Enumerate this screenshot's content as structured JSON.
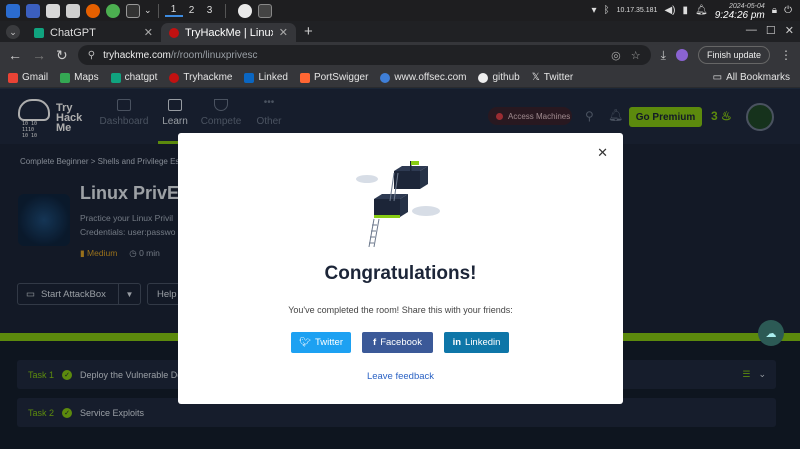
{
  "taskbar": {
    "workspaces": [
      "1",
      "2",
      "3"
    ],
    "ip": "10.17.35.181",
    "date": "2024-05-04",
    "time": "9:24:26 pm"
  },
  "browser": {
    "tabs": [
      {
        "title": "ChatGPT",
        "active": false
      },
      {
        "title": "TryHackMe | Linux PrivEsc",
        "active": true
      }
    ],
    "url_host": "tryhackme.com",
    "url_path": "/r/room/linuxprivesc",
    "finish_update": "Finish update",
    "bookmarks": [
      "Gmail",
      "Maps",
      "chatgpt",
      "Tryhackme",
      "Linked",
      "PortSwigger",
      "www.offsec.com",
      "github",
      "Twitter"
    ],
    "all_bookmarks": "All Bookmarks"
  },
  "nav": {
    "logo_word": "Try Hack Me",
    "logo_bits": "10 10\n1110\n10 10",
    "items": [
      "Dashboard",
      "Learn",
      "Compete",
      "Other"
    ],
    "access_machines": "Access Machines",
    "go_premium": "Go Premium",
    "streak": "3"
  },
  "room": {
    "breadcrumb": "Complete Beginner > Shells and Privilege Esc",
    "title": "Linux PrivE",
    "desc_line1": "Practice your Linux Privil",
    "desc_line2": "Credentials: user:passwo",
    "difficulty": "Medium",
    "duration": "0 min",
    "start_attackbox": "Start AttackBox",
    "help": "Help"
  },
  "tasks": [
    {
      "num": "Task 1",
      "title": "Deploy the Vulnerable Debi"
    },
    {
      "num": "Task 2",
      "title": "Service Exploits"
    }
  ],
  "modal": {
    "title": "Congratulations!",
    "message": "You've completed the room! Share this with your friends:",
    "twitter": "Twitter",
    "facebook": "Facebook",
    "linkedin": "Linkedin",
    "feedback": "Leave feedback"
  },
  "colors": {
    "thm_green": "#88cc14",
    "twitter": "#1da1f2",
    "facebook": "#3b5998",
    "linkedin": "#0e76a8"
  }
}
